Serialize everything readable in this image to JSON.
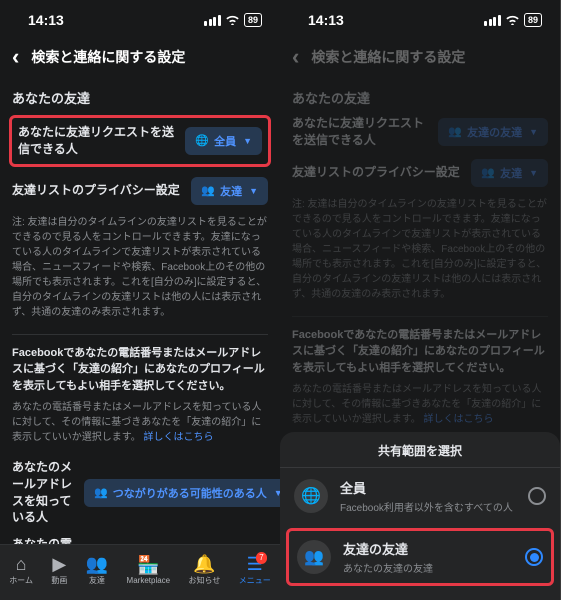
{
  "status": {
    "time": "14:13",
    "battery": "89"
  },
  "header": {
    "title": "検索と連絡に関する設定"
  },
  "sectionFriends": "あなたの友達",
  "rowFriendReq": "あなたに友達リクエストを送信できる人",
  "pillEveryone": "全員",
  "pillFriendsOfFriends": "友達の友達",
  "rowFriendList": "友達リストのプライバシー設定",
  "pillFriends": "友達",
  "friendListDesc": "注: 友達は自分のタイムラインの友達リストを見ることができるので見る人をコントロールできます。友達になっている人のタイムラインで友達リストが表示されている場合、ニュースフィードや検索、Facebook上のその他の場所でも表示されます。これを[自分のみ]に設定すると、自分のタイムラインの友達リストは他の人には表示されず、共通の友達のみ表示されます。",
  "phoneEmailHeading": "Facebookであなたの電話番号またはメールアドレスに基づく「友達の紹介」にあなたのプロフィールを表示してもよい相手を選択してください。",
  "phoneEmailDesc": "あなたの電話番号またはメールアドレスを知っている人に対して、その情報に基づきあなたを「友達の紹介」に表示していいか選択します。 ",
  "learnMore": "詳しくはこちら",
  "rowEmail": "あなたのメールアドレスを知っている人",
  "rowPhone": "あなたの電話番号を知っている人",
  "pillMayKnow": "つながりがある可能性のある人",
  "nav": {
    "home": "ホーム",
    "video": "動画",
    "friends": "友達",
    "marketplace": "Marketplace",
    "notifications": "お知らせ",
    "menu": "メニュー",
    "badge": "7"
  },
  "sheet": {
    "title": "共有範囲を選択",
    "opt1": {
      "label": "全員",
      "sub": "Facebook利用者以外を含むすべての人"
    },
    "opt2": {
      "label": "友達の友達",
      "sub": "あなたの友達の友達"
    }
  }
}
